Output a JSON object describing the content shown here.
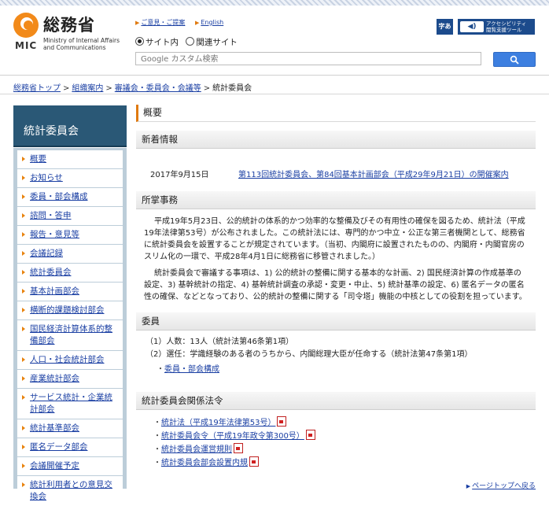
{
  "header": {
    "logo_name": "総務省",
    "logo_mic": "MIC",
    "logo_en_1": "Ministry of Internal Affairs",
    "logo_en_2": "and Communications",
    "links": [
      "ご意見・ご提案",
      "English"
    ],
    "radio_site": "サイト内",
    "radio_related": "関連サイト",
    "search_placeholder": "Google カスタム検索",
    "accessibility_small": "字あ",
    "accessibility_label_1": "アクセシビリティ",
    "accessibility_label_2": "閲覧支援ツール"
  },
  "breadcrumb": {
    "items": [
      "総務省トップ",
      "組織案内",
      "審議会・委員会・会議等"
    ],
    "separator": ">",
    "current": "統計委員会"
  },
  "sidebar": {
    "title": "統計委員会",
    "items": [
      "概要",
      "お知らせ",
      "委員・部会構成",
      "諮問・答申",
      "報告・意見等",
      "会議記録",
      "統計委員会",
      "基本計画部会",
      "横断的課題検討部会",
      "国民経済計算体系的整備部会",
      "人口・社会統計部会",
      "産業統計部会",
      "サービス統計・企業統計部会",
      "統計基準部会",
      "匿名データ部会",
      "会議開催予定",
      "統計利用者との意見交換会"
    ]
  },
  "main": {
    "heading": "概要",
    "news_title": "新着情報",
    "news_date": "2017年9月15日",
    "news_link": "第113回統計委員会、第84回基本計画部会（平成29年9月21日）の開催案内",
    "duties_title": "所掌事務",
    "duties_p1": "平成19年5月23日、公的統計の体系的かつ効率的な整備及びその有用性の確保を図るため、統計法（平成19年法律第53号）が公布されました。この統計法には、専門的かつ中立・公正な第三者機関として、総務省に統計委員会を設置することが規定されています。（当初、内閣府に設置されたものの、内閣府・内閣官房のスリム化の一環で、平成28年4月1日に総務省に移管されました。）",
    "duties_p2": "統計委員会で審議する事項は、1) 公的統計の整備に関する基本的な計画、2) 国民経済計算の作成基準の設定、3) 基幹統計の指定、4) 基幹統計調査の承認・変更・中止、5) 統計基準の設定、6) 匿名データの匿名性の確保、などとなっており、公的統計の整備に関する「司令塔」機能の中核としての役割を担っています。",
    "members_title": "委員",
    "members_1": "（1）人数：13人（統計法第46条第1項）",
    "members_2": "（2）選任：学識経験のある者のうちから、内閣総理大臣が任命する（統計法第47条第1項）",
    "members_link": "委員・部会構成",
    "laws_title": "統計委員会関係法令",
    "laws": [
      "統計法（平成19年法律第53号）",
      "統計委員会令（平成19年政令第300号）",
      "統計委員会運営規則",
      "統計委員会部会設置内規"
    ],
    "pagetop": "ページトップへ戻る"
  }
}
